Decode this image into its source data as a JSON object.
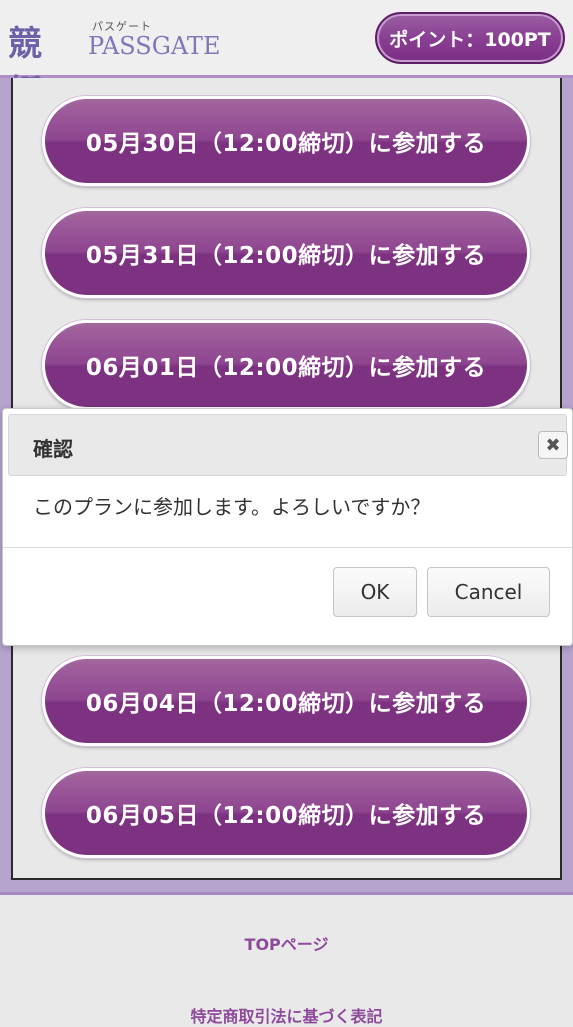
{
  "header": {
    "logo_kanji": "競艇",
    "logo_ruby": "パスゲート",
    "logo_text": "PASSGATE",
    "points_label": "ポイント：100PT"
  },
  "plans": [
    {
      "label": "05月30日（12:00締切）に参加する"
    },
    {
      "label": "05月31日（12:00締切）に参加する"
    },
    {
      "label": "06月01日（12:00締切）に参加する"
    },
    {
      "label": "06月04日（12:00締切）に参加する"
    },
    {
      "label": "06月05日（12:00締切）に参加する"
    }
  ],
  "dialog": {
    "title": "確認",
    "close_glyph": "✖",
    "message": "このプランに参加します。よろしいですか？",
    "ok_label": "OK",
    "cancel_label": "Cancel"
  },
  "footer": {
    "top_link": "TOPページ",
    "legal_link": "特定商取引法に基づく表記"
  },
  "colors": {
    "accent_purple": "#8e4590",
    "frame_lavender": "#b6a4cf",
    "link_purple": "#8e4a9a"
  }
}
